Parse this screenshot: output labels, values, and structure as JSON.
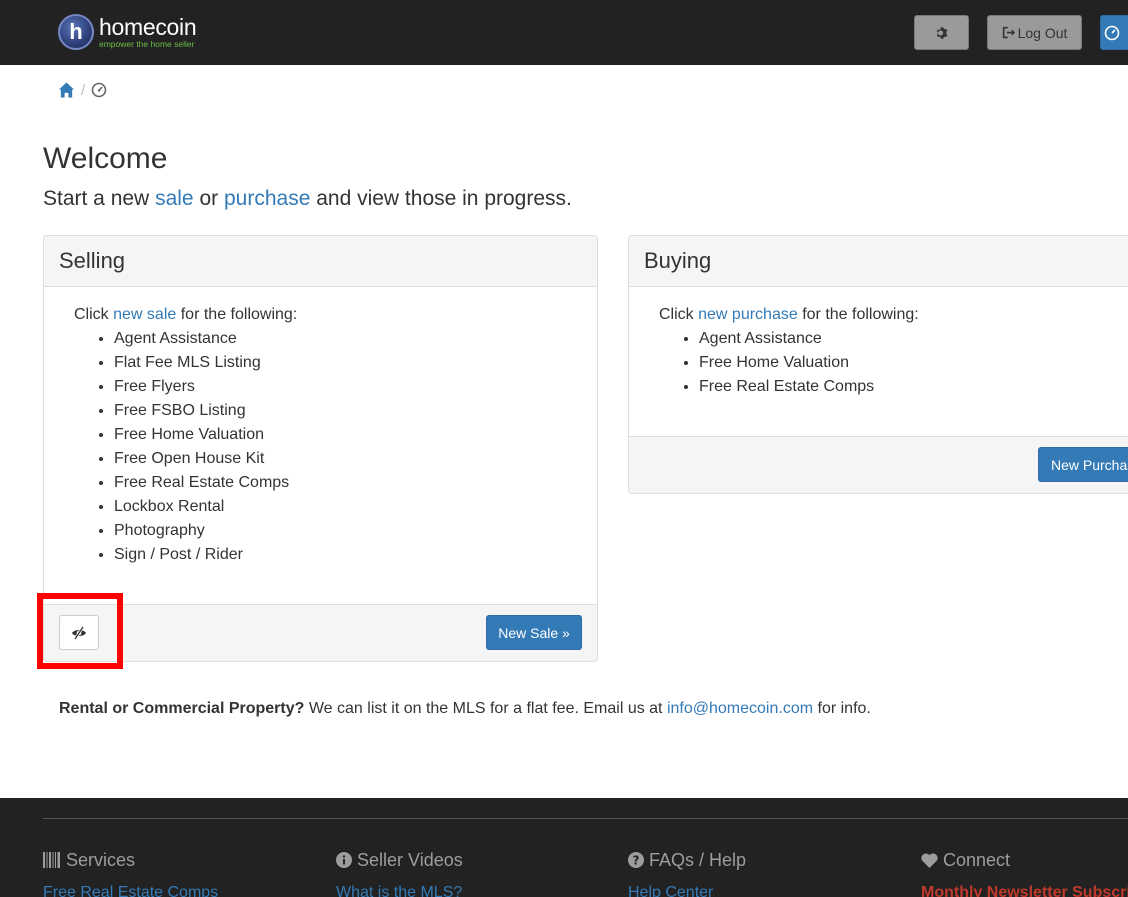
{
  "brand": {
    "name": "homecoin",
    "tagline": "empower the home seller",
    "logo_letter": "h"
  },
  "nav": {
    "settings_icon": "gear-icon",
    "logout_label": "Log Out",
    "dashboard_icon": "dashboard-icon"
  },
  "breadcrumb": {
    "home_icon": "home-icon",
    "separator": "/",
    "current_icon": "dashboard-icon"
  },
  "welcome": {
    "title": "Welcome",
    "lead_start": "Start a new",
    "lead_sale": "sale",
    "lead_or": "or",
    "lead_purchase": "purchase",
    "lead_end": "and view those in progress."
  },
  "selling": {
    "heading": "Selling",
    "intro_before": "Click",
    "intro_link": "new sale",
    "intro_after": "for the following:",
    "items": [
      "Agent Assistance",
      "Flat Fee MLS Listing",
      "Free Flyers",
      "Free FSBO Listing",
      "Free Home Valuation",
      "Free Open House Kit",
      "Free Real Estate Comps",
      "Lockbox Rental",
      "Photography",
      "Sign / Post / Rider"
    ],
    "button": "New Sale »"
  },
  "buying": {
    "heading": "Buying",
    "intro_before": "Click",
    "intro_link": "new purchase",
    "intro_after": "for the following:",
    "items": [
      "Agent Assistance",
      "Free Home Valuation",
      "Free Real Estate Comps"
    ],
    "button": "New Purchase »"
  },
  "rental": {
    "bold": "Rental or Commercial Property?",
    "text": "We can list it on the MLS for a flat fee. Email us at",
    "email": "info@homecoin.com",
    "end": "for info."
  },
  "footer": {
    "columns": [
      {
        "title": "Services",
        "icon": "barcode-icon",
        "link": "Free Real Estate Comps"
      },
      {
        "title": "Seller Videos",
        "icon": "info-icon",
        "link": "What is the MLS?"
      },
      {
        "title": "FAQs / Help",
        "icon": "question-icon",
        "link": "Help Center"
      },
      {
        "title": "Connect",
        "icon": "heart-icon",
        "link": "Monthly Newsletter Subscription"
      }
    ]
  },
  "colors": {
    "navbar": "#222222",
    "primary": "#337ab7",
    "brand_green": "#6cbd45",
    "highlight": "#ff0000"
  }
}
